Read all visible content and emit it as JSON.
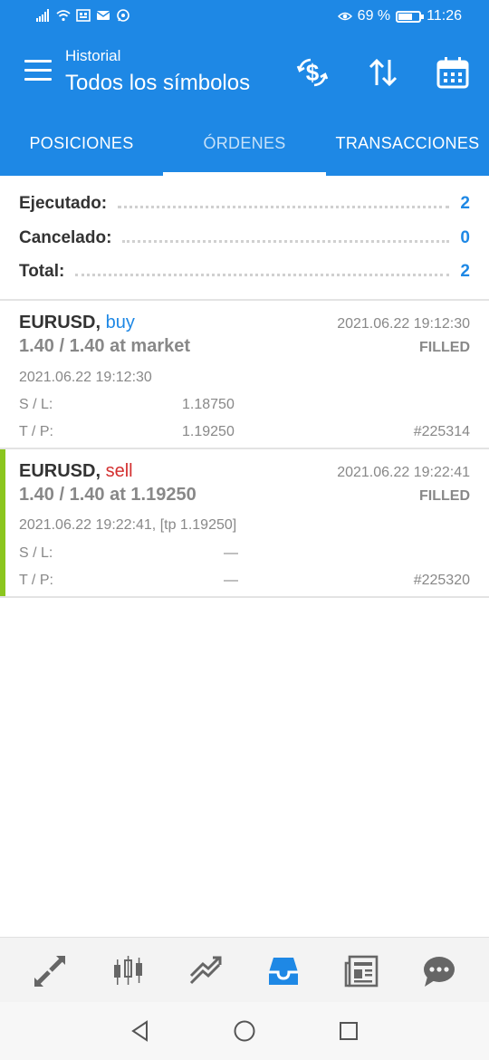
{
  "status_bar": {
    "battery": "69 %",
    "battery_level": 0.69,
    "time": "11:26"
  },
  "app_bar": {
    "subtitle": "Historial",
    "title": "Todos los símbolos"
  },
  "tabs": [
    {
      "label": "POSICIONES",
      "active": false
    },
    {
      "label": "ÓRDENES",
      "active": true
    },
    {
      "label": "TRANSACCIONES",
      "active": false
    }
  ],
  "summary": {
    "executed_label": "Ejecutado:",
    "executed_value": "2",
    "cancelled_label": "Cancelado:",
    "cancelled_value": "0",
    "total_label": "Total:",
    "total_value": "2"
  },
  "orders": [
    {
      "symbol": "EURUSD,",
      "side": "buy",
      "time": "2021.06.22 19:12:30",
      "volume": "1.40 / 1.40 at market",
      "status": "FILLED",
      "open_time": "2021.06.22 19:12:30",
      "sl_label": "S / L:",
      "sl_value": "1.18750",
      "tp_label": "T / P:",
      "tp_value": "1.19250",
      "ticket": "#225314"
    },
    {
      "symbol": "EURUSD,",
      "side": "sell",
      "time": "2021.06.22 19:22:41",
      "volume": "1.40 / 1.40 at 1.19250",
      "status": "FILLED",
      "open_time": "2021.06.22 19:22:41, [tp 1.19250]",
      "sl_label": "S / L:",
      "sl_value": "—",
      "tp_label": "T / P:",
      "tp_value": "—",
      "ticket": "#225320"
    }
  ],
  "colors": {
    "accent": "#1e88e5",
    "buy": "#1e88e5",
    "sell": "#d32f2f",
    "marker": "#8bc61e"
  },
  "bottom_nav": [
    "quotes-icon",
    "chart-icon",
    "trade-icon",
    "history-icon",
    "news-icon",
    "chat-icon"
  ]
}
